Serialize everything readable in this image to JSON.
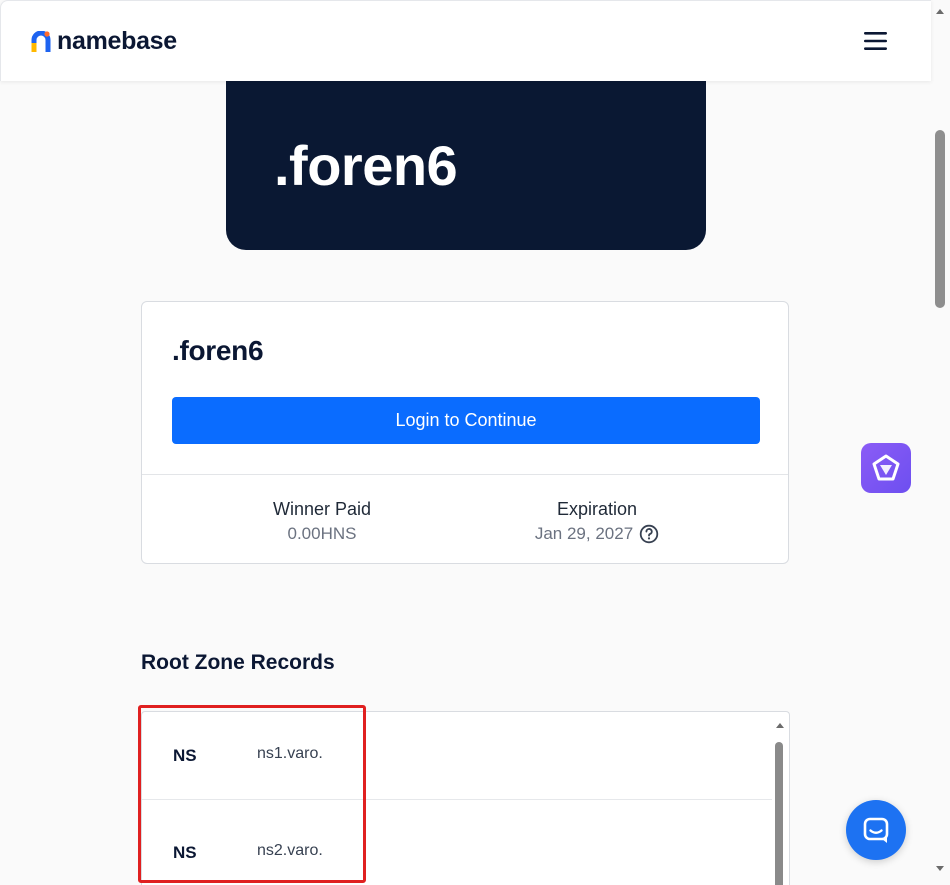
{
  "brand": {
    "name": "namebase"
  },
  "hero": {
    "domain": ".foren6"
  },
  "card": {
    "title": ".foren6",
    "login_label": "Login to Continue",
    "winner_paid_label": "Winner Paid",
    "winner_paid_value": "0.00HNS",
    "expiration_label": "Expiration",
    "expiration_value": "Jan 29, 2027"
  },
  "records_section": {
    "title": "Root Zone Records",
    "rows": [
      {
        "type": "NS",
        "value": "ns1.varo."
      },
      {
        "type": "NS",
        "value": "ns2.varo."
      }
    ]
  },
  "icons": {
    "menu": "hamburger-menu-icon",
    "help": "question-circle-icon",
    "ai": "ai-assistant-icon",
    "chat": "chat-support-icon"
  },
  "colors": {
    "brand_navy": "#0a1833",
    "primary_blue": "#0a6cff",
    "highlight_red": "#e02020",
    "ai_purple": "#7c5cf4",
    "chat_blue": "#1d72f2"
  }
}
